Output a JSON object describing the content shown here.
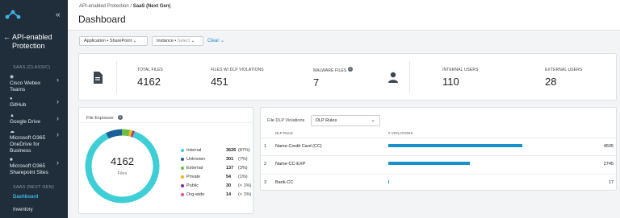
{
  "sidebar": {
    "collapse_glyph": "«",
    "back_glyph": "←",
    "back_label": "API-enabled Protection",
    "section_classic": "SAAS (CLASSIC)",
    "classic_items": [
      {
        "label": "Cisco Webex Teams",
        "icon": "webex-icon"
      },
      {
        "label": "GitHub",
        "icon": "github-icon"
      },
      {
        "label": "Google Drive",
        "icon": "google-drive-icon"
      },
      {
        "label": "Microsoft O365 OneDrive for Business",
        "icon": "onedrive-icon"
      },
      {
        "label": "Microsoft O365 Sharepoint Sites",
        "icon": "sharepoint-icon"
      }
    ],
    "section_next": "SAAS (NEXT GEN)",
    "active_item": "Dashboard",
    "next_item": "Inventory"
  },
  "header": {
    "breadcrumb_parent": "API-enabled Protection",
    "breadcrumb_sep": "/",
    "breadcrumb_current": "SaaS (Next Gen)",
    "title": "Dashboard"
  },
  "filters": {
    "application_label": "Application •",
    "application_value": "SharePoint",
    "instance_label": "Instance •",
    "instance_value": "Select",
    "clear_label": "Clear"
  },
  "stats": {
    "total_files_label": "TOTAL FILES",
    "total_files_value": "4162",
    "dlp_label": "FILES W/ DLP VIOLATIONS",
    "dlp_value": "451",
    "malware_label": "MALWARE FILES",
    "malware_value": "7",
    "internal_label": "INTERNAL USERS",
    "internal_value": "110",
    "external_label": "EXTERNAL USERS",
    "external_value": "28"
  },
  "exposure": {
    "title": "File Exposure",
    "center_value": "4162",
    "center_label": "Files",
    "legend": [
      {
        "name": "Internal",
        "count": "3626",
        "pct": "(87%)",
        "value": 3626,
        "color": "#3ecfd6"
      },
      {
        "name": "Unknown",
        "count": "301",
        "pct": "(7%)",
        "value": 301,
        "color": "#1a5f97"
      },
      {
        "name": "External",
        "count": "137",
        "pct": "(3%)",
        "value": 137,
        "color": "#6cbf3c"
      },
      {
        "name": "Private",
        "count": "54",
        "pct": "(1%)",
        "value": 54,
        "color": "#f2b51a"
      },
      {
        "name": "Public",
        "count": "30",
        "pct": "(< 1%)",
        "value": 30,
        "color": "#7a2f8f"
      },
      {
        "name": "Org-wide",
        "count": "14",
        "pct": "(< 1%)",
        "value": 14,
        "color": "#e64f8e"
      }
    ]
  },
  "dlp": {
    "title": "File DLP Violations",
    "select_value": "DLP Rules",
    "col_rule": "DLP RULE",
    "col_violations": "# VIOLATIONS",
    "max_value": 4505,
    "rows": [
      {
        "num": "1",
        "rule": "Name-Credit Card (CC)",
        "count": "4505",
        "value": 4505
      },
      {
        "num": "2",
        "rule": "Name-CC-EXP",
        "count": "2745",
        "value": 2745
      },
      {
        "num": "3",
        "rule": "Bank-CC",
        "count": "17",
        "value": 17
      }
    ]
  }
}
